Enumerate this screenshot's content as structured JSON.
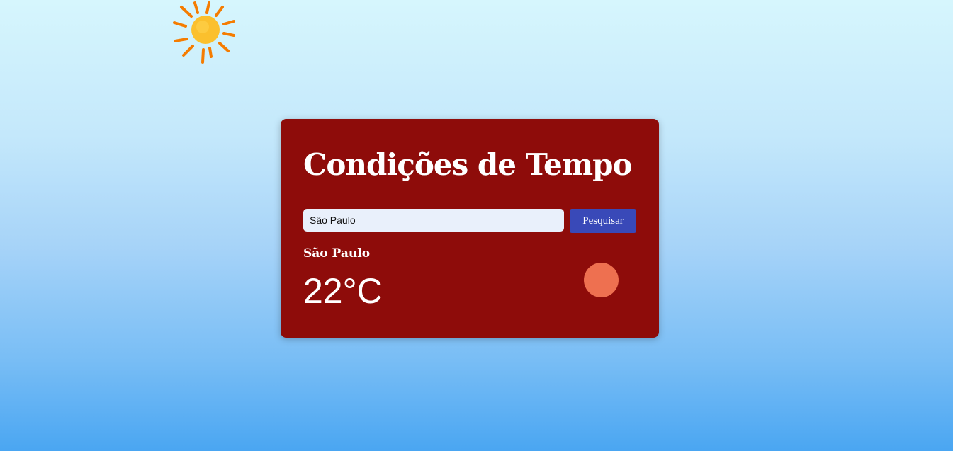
{
  "page": {
    "background_top": "#d6f6fd",
    "background_bottom": "#4aa6f2"
  },
  "decoration": {
    "icon": "sun-icon",
    "sun_color": "#fbc02d",
    "ray_color": "#f57c00"
  },
  "card": {
    "background": "#8e0c0a",
    "title": "Condições de Tempo",
    "search": {
      "value": "São Paulo",
      "placeholder": "",
      "button_label": "Pesquisar",
      "button_color": "#3949b8"
    },
    "weather": {
      "city": "São Paulo",
      "temperature": "22°C",
      "icon": "weather-icon",
      "icon_color": "#ee7050"
    }
  }
}
